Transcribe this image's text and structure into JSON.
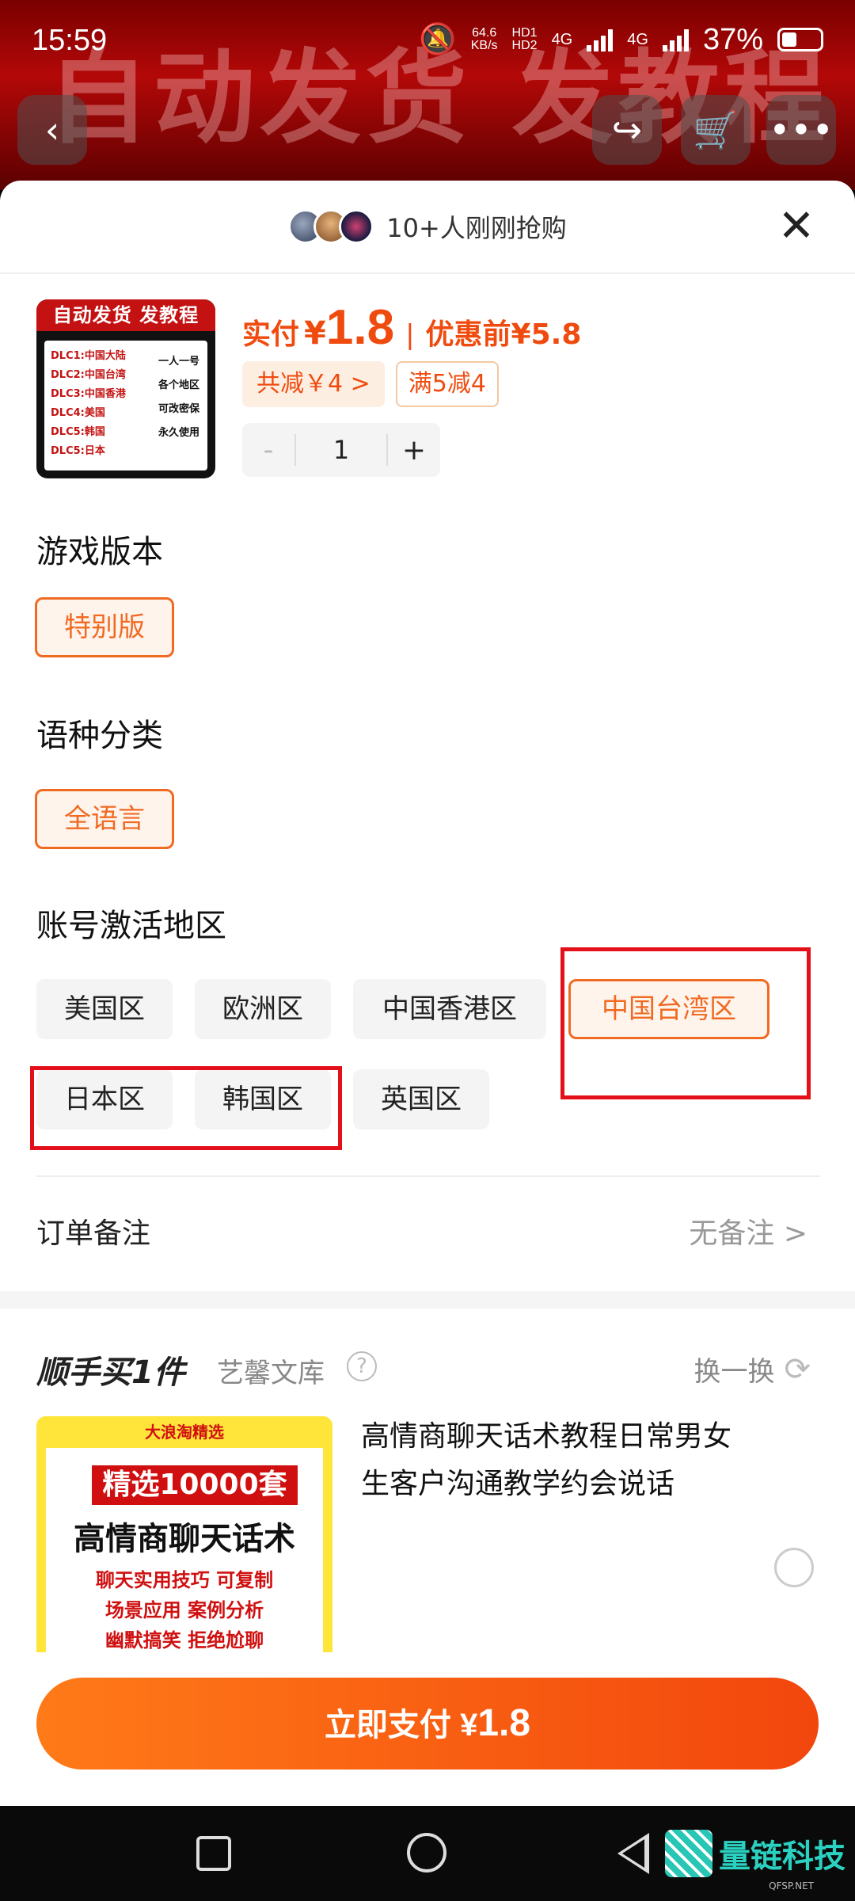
{
  "status_bar": {
    "time": "15:59",
    "speed_value": "64.6",
    "speed_unit": "KB/s",
    "hd1": "HD1",
    "hd2": "HD2",
    "net1": "4G",
    "net2": "4G",
    "battery": "37%"
  },
  "background": {
    "title": "自动发货 发教程"
  },
  "sheet": {
    "buyers": "10+人刚刚抢购",
    "close_glyph": "✕"
  },
  "product": {
    "thumb_title": "自动发货 发教程",
    "thumb_left": [
      "DLC1:中国大陆",
      "DLC2:中国台湾",
      "DLC3:中国香港",
      "DLC4:美国",
      "DLC5:韩国",
      "DLC5:日本"
    ],
    "thumb_right": [
      "一人一号",
      "各个地区",
      "可改密保",
      "永久使用"
    ],
    "paid_label": "实付",
    "currency": "¥",
    "paid_amount": "1.8",
    "separator": "|",
    "before_label": "优惠前",
    "before_amount": "¥5.8",
    "discount_total": "共减￥4 >",
    "discount_rule": "满5减4",
    "quantity": "1",
    "minus": "-",
    "plus": "+"
  },
  "version": {
    "title": "游戏版本",
    "option": "特别版"
  },
  "language": {
    "title": "语种分类",
    "option": "全语言"
  },
  "region": {
    "title": "账号激活地区",
    "options": [
      "美国区",
      "欧洲区",
      "中国香港区",
      "中国台湾区",
      "日本区",
      "韩国区",
      "英国区"
    ],
    "selected": "中国台湾区"
  },
  "order_note": {
    "label": "订单备注",
    "value": "无备注 >"
  },
  "addon": {
    "title": "顺手买1件",
    "shop": "艺馨文库",
    "help": "?",
    "refresh_label": "换一换",
    "refresh_icon": "⟳",
    "img_brand": "大浪淘精选",
    "img_banner": "精选10000套",
    "img_big": "高情商聊天话术",
    "img_lines": [
      "聊天实用技巧 可复制",
      "场景应用 案例分析",
      "幽默搞笑 拒绝尬聊"
    ],
    "name": "高情商聊天话术教程日常男女生客户沟通教学约会说话"
  },
  "pay": {
    "label": "立即支付",
    "currency": "¥",
    "amount": "1.8"
  },
  "watermark": {
    "name": "量链科技",
    "domain": "QFSP.NET"
  },
  "colors": {
    "accent": "#f04b0f",
    "highlight_box": "#e3101a"
  }
}
